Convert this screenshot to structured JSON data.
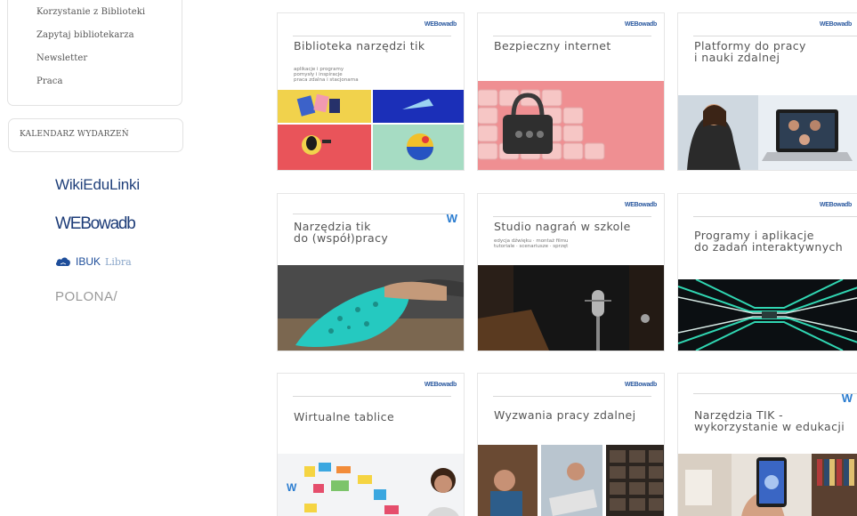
{
  "sidebar": {
    "menu_items": [
      "Korzystanie z Biblioteki",
      "Zapytaj bibliotekarza",
      "Newsletter",
      "Praca"
    ],
    "calendar_label": "KALENDARZ WYDARZEŃ"
  },
  "partners": {
    "wiki": "WikiEduLinki",
    "webowadb": "WEBowadb",
    "ibuk": "IBUK",
    "ibuk_suffix": "Libra",
    "polona": "POLONA/"
  },
  "tiles": [
    {
      "title": "Biblioteka narzędzi tik",
      "brand": "WEBowadb",
      "subtitle": "aplikacje i programy\npomysły i inspiracje\npraca zdalna i stacjonarna"
    },
    {
      "title": "Bezpieczny internet",
      "brand": "WEBowadb"
    },
    {
      "title": "Platformy do pracy\ni nauki zdalnej",
      "brand": "WEBowadb"
    },
    {
      "title": "Narzędzia tik\ndo (współ)pracy",
      "brand_short": "W"
    },
    {
      "title": "Studio nagrań w szkole",
      "brand": "WEBowadb",
      "subtitle": "edycja dźwięku · montaż filmu\ntutoriale · scenariusze · sprzęt"
    },
    {
      "title": "Programy i aplikacje\ndo zadań interaktywnych",
      "brand": "WEBowadb"
    },
    {
      "title": "Wirtualne tablice",
      "brand": "WEBowadb"
    },
    {
      "title": "Wyzwania pracy zdalnej",
      "brand": "WEBowadb"
    },
    {
      "title": "Narzędzia TIK -\nwykorzystanie w edukacji",
      "brand_short": "W"
    }
  ],
  "colors": {
    "brand_blue": "#1d3c78",
    "tile_border": "#e6e6e6",
    "bezpieczny_bg": "#ef8f92"
  },
  "icons": {
    "ibuk_logo": "cloud-book-icon"
  }
}
